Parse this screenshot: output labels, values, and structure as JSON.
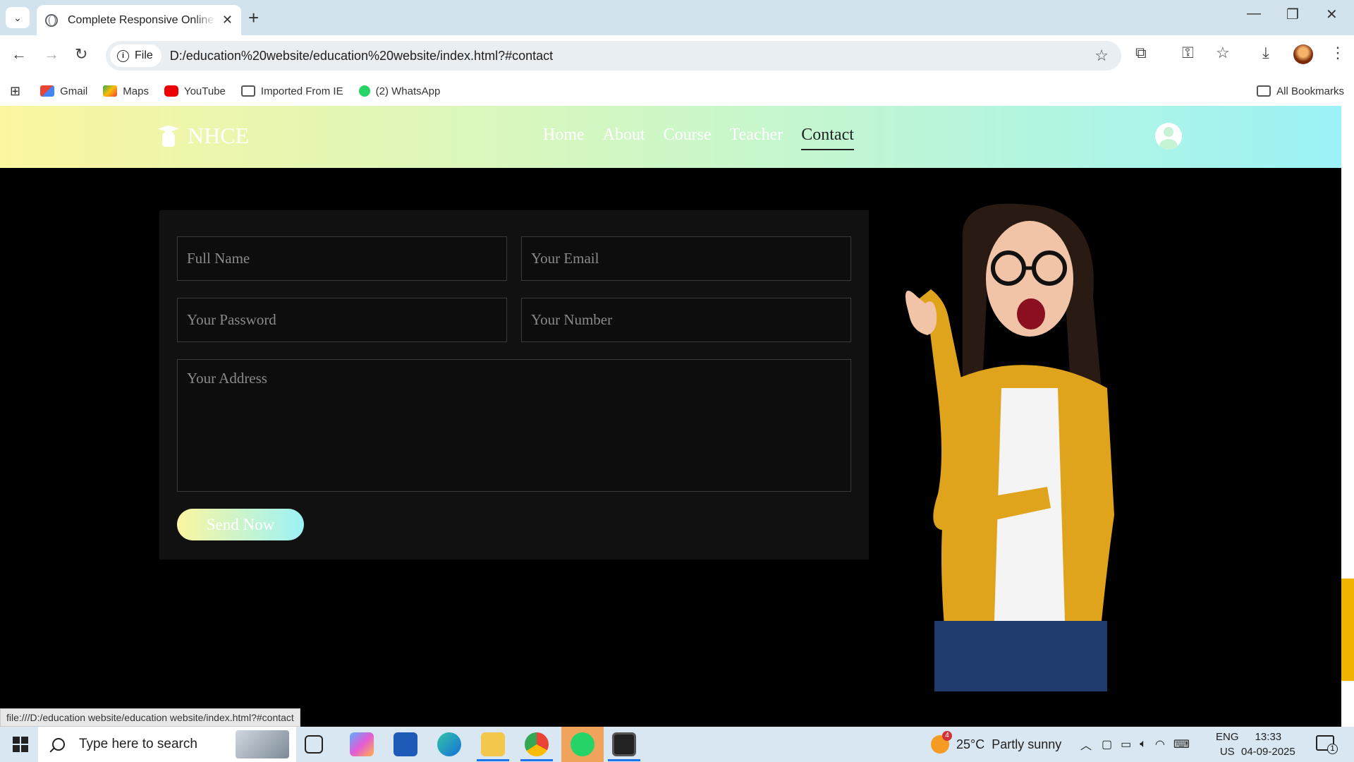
{
  "browser": {
    "tab_title": "Complete Responsive Online St",
    "address_chip": "File",
    "url": "D:/education%20website/education%20website/index.html?#contact",
    "status_url": "file:///D:/education website/education website/index.html?#contact"
  },
  "bookmarks": [
    {
      "label": "Gmail",
      "icon": "gmail-icon"
    },
    {
      "label": "Maps",
      "icon": "maps-icon"
    },
    {
      "label": "YouTube",
      "icon": "youtube-icon"
    },
    {
      "label": "Imported From IE",
      "icon": "folder-icon"
    },
    {
      "label": "(2) WhatsApp",
      "icon": "whatsapp-icon"
    }
  ],
  "all_bookmarks": "All Bookmarks",
  "site": {
    "logo_text": "NHCE",
    "nav": [
      "Home",
      "About",
      "Course",
      "Teacher",
      "Contact"
    ],
    "active_nav": "Contact",
    "colors": {
      "header_start": "#fbf6a0",
      "header_end": "#9cf2f6",
      "scroll_thumb": "#f0b400"
    }
  },
  "contact_form": {
    "full_name_placeholder": "Full Name",
    "email_placeholder": "Your Email",
    "password_placeholder": "Your Password",
    "number_placeholder": "Your Number",
    "address_placeholder": "Your Address",
    "send_label": "Send Now"
  },
  "taskbar": {
    "search_placeholder": "Type here to search",
    "weather": "25°C  Partly sunny",
    "weather_badge": "4",
    "lang_top": "ENG",
    "lang_bottom": "US",
    "time": "13:33",
    "date": "04-09-2025",
    "notification_count": "1"
  }
}
